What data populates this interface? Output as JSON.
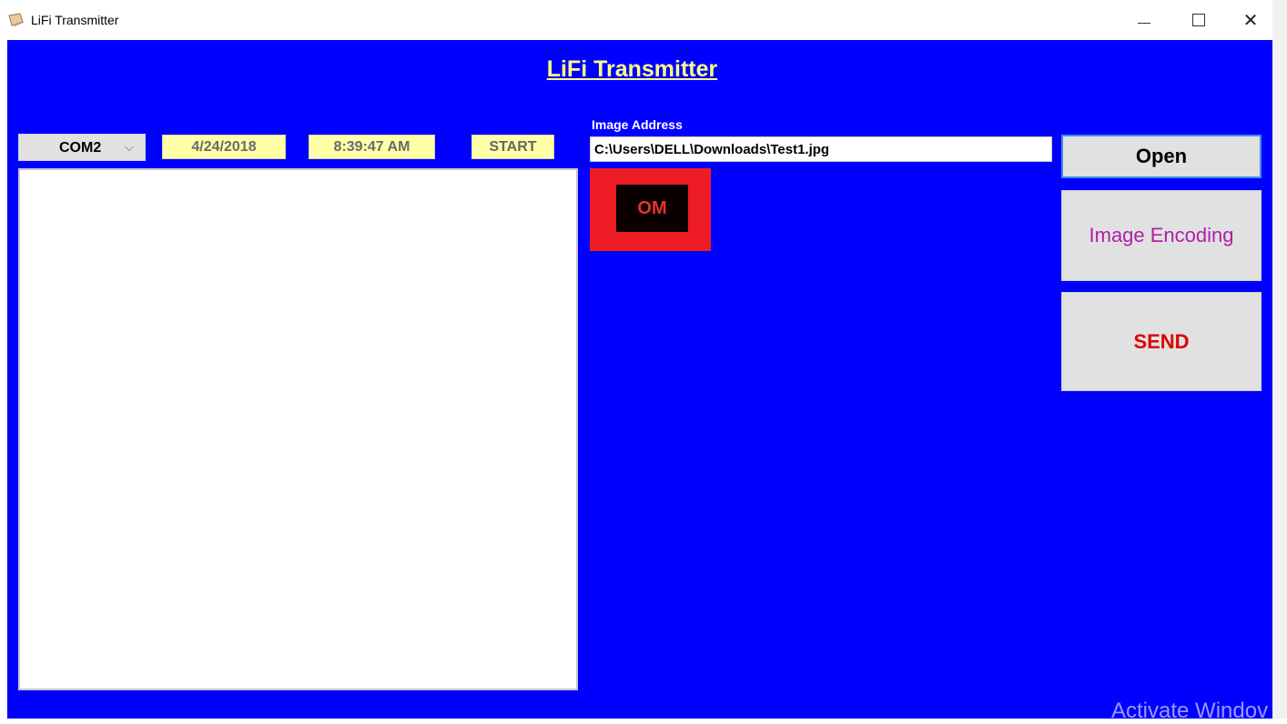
{
  "window": {
    "title": "LiFi Transmitter",
    "icon": "scroll-icon",
    "controls": {
      "minimize": "minimize-icon",
      "maximize": "maximize-icon",
      "close_glyph": "✕"
    }
  },
  "app": {
    "heading": "LiFi Transmitter",
    "background_color": "#0000ff",
    "heading_color": "#ffff80"
  },
  "toolbar": {
    "port_value": "COM2",
    "port_arrow": "⌵",
    "date": "4/24/2018",
    "time": "8:39:47 AM",
    "start_label": "START"
  },
  "image": {
    "label": "Image Address",
    "path": "C:\\Users\\DELL\\Downloads\\Test1.jpg"
  },
  "status": {
    "text": "OM",
    "color": "#ee1c24"
  },
  "buttons": {
    "open": "Open",
    "encode": "Image Encoding",
    "send": "SEND"
  },
  "watermark": "Activate Windov"
}
